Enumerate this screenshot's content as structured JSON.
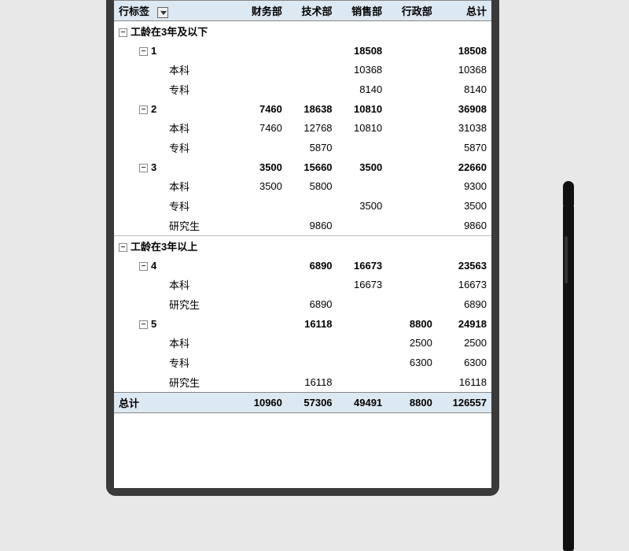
{
  "header": {
    "row_label": "行标签",
    "columns": [
      "财务部",
      "技术部",
      "销售部",
      "行政部",
      "总计"
    ]
  },
  "groups": [
    {
      "name": "工龄在3年及以下",
      "subgroups": [
        {
          "name": "1",
          "vals": [
            "",
            "",
            "18508",
            "",
            "18508"
          ],
          "leaves": [
            {
              "name": "本科",
              "vals": [
                "",
                "",
                "10368",
                "",
                "10368"
              ]
            },
            {
              "name": "专科",
              "vals": [
                "",
                "",
                "8140",
                "",
                "8140"
              ]
            }
          ]
        },
        {
          "name": "2",
          "vals": [
            "7460",
            "18638",
            "10810",
            "",
            "36908"
          ],
          "leaves": [
            {
              "name": "本科",
              "vals": [
                "7460",
                "12768",
                "10810",
                "",
                "31038"
              ]
            },
            {
              "name": "专科",
              "vals": [
                "",
                "5870",
                "",
                "",
                "5870"
              ]
            }
          ]
        },
        {
          "name": "3",
          "vals": [
            "3500",
            "15660",
            "3500",
            "",
            "22660"
          ],
          "leaves": [
            {
              "name": "本科",
              "vals": [
                "3500",
                "5800",
                "",
                "",
                "9300"
              ]
            },
            {
              "name": "专科",
              "vals": [
                "",
                "",
                "3500",
                "",
                "3500"
              ]
            },
            {
              "name": "研究生",
              "vals": [
                "",
                "9860",
                "",
                "",
                "9860"
              ]
            }
          ]
        }
      ]
    },
    {
      "name": "工龄在3年以上",
      "subgroups": [
        {
          "name": "4",
          "vals": [
            "",
            "6890",
            "16673",
            "",
            "23563"
          ],
          "leaves": [
            {
              "name": "本科",
              "vals": [
                "",
                "",
                "16673",
                "",
                "16673"
              ]
            },
            {
              "name": "研究生",
              "vals": [
                "",
                "6890",
                "",
                "",
                "6890"
              ]
            }
          ]
        },
        {
          "name": "5",
          "vals": [
            "",
            "16118",
            "",
            "8800",
            "24918"
          ],
          "leaves": [
            {
              "name": "本科",
              "vals": [
                "",
                "",
                "",
                "2500",
                "2500"
              ]
            },
            {
              "name": "专科",
              "vals": [
                "",
                "",
                "",
                "6300",
                "6300"
              ]
            },
            {
              "name": "研究生",
              "vals": [
                "",
                "16118",
                "",
                "",
                "16118"
              ]
            }
          ]
        }
      ]
    }
  ],
  "total": {
    "name": "总计",
    "vals": [
      "10960",
      "57306",
      "49491",
      "8800",
      "126557"
    ]
  },
  "icons": {
    "collapse": "⊟",
    "dropdown": "dropdown"
  }
}
